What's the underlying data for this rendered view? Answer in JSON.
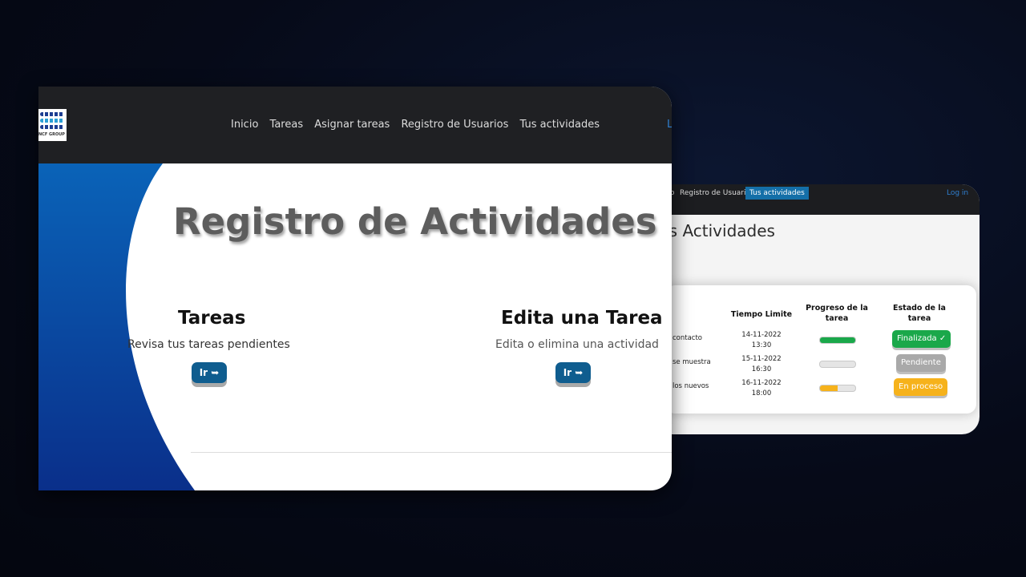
{
  "back_window": {
    "nav": {
      "items": [
        "o",
        "Registro de Usuarios",
        "Tus actividades"
      ],
      "login": "Log in",
      "active_color": "#146fa8"
    },
    "title": "us Actividades",
    "table": {
      "headers": [
        "n",
        "Tiempo Limite",
        "Progreso de la tarea",
        "Estado de la tarea"
      ],
      "rows": [
        {
          "desc": "contacto",
          "date": "14-11-2022",
          "time": "13:30",
          "progress": 1.0,
          "progress_color": "#1aa84a",
          "status": "Finalizada ✓",
          "status_color": "#1aa84a"
        },
        {
          "desc": "se muestra",
          "date": "15-11-2022",
          "time": "16:30",
          "progress": 0.0,
          "progress_color": "#e5e5e5",
          "status": "Pendiente",
          "status_color": "#a9a9a9"
        },
        {
          "desc": "los nuevos",
          "date": "16-11-2022",
          "time": "18:00",
          "progress": 0.5,
          "progress_color": "#f6b21b",
          "status": "En proceso",
          "status_color": "#f6b21b"
        }
      ]
    }
  },
  "front_window": {
    "logo": {
      "text": "NCF GROUP"
    },
    "nav": {
      "links": [
        "Inicio",
        "Tareas",
        "Asignar tareas",
        "Registro de Usuarios",
        "Tus actividades"
      ],
      "login": "L"
    },
    "main": {
      "title": "Registro de Actividades",
      "sections": [
        {
          "title": "Tareas",
          "subtitle": "Revisa tus tareas pendientes",
          "button": "Ir ➥"
        },
        {
          "title": "Edita una Tarea",
          "subtitle": "Edita o elimina una actividad",
          "button": "Ir ➥"
        }
      ],
      "accent_color": "#0a56b0"
    }
  }
}
